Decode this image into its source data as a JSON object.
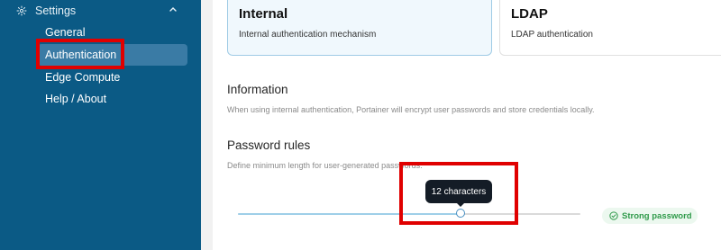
{
  "sidebar": {
    "section_label": "Settings",
    "items": [
      {
        "label": "General"
      },
      {
        "label": "Authentication"
      },
      {
        "label": "Edge Compute"
      },
      {
        "label": "Help / About"
      }
    ]
  },
  "auth_methods": [
    {
      "title": "Internal",
      "description": "Internal authentication mechanism",
      "selected": true
    },
    {
      "title": "LDAP",
      "description": "LDAP authentication",
      "selected": false
    }
  ],
  "information": {
    "title": "Information",
    "description": "When using internal authentication, Portainer will encrypt user passwords and store credentials locally."
  },
  "password_rules": {
    "title": "Password rules",
    "description": "Define minimum length for user-generated passwords.",
    "slider_value_fraction": 0.65,
    "tooltip": "12 characters",
    "strength_badge": "Strong password"
  },
  "colors": {
    "sidebar_bg": "#0b5a85",
    "highlight_red": "#e00000",
    "strong_green": "#2f9a4a"
  }
}
